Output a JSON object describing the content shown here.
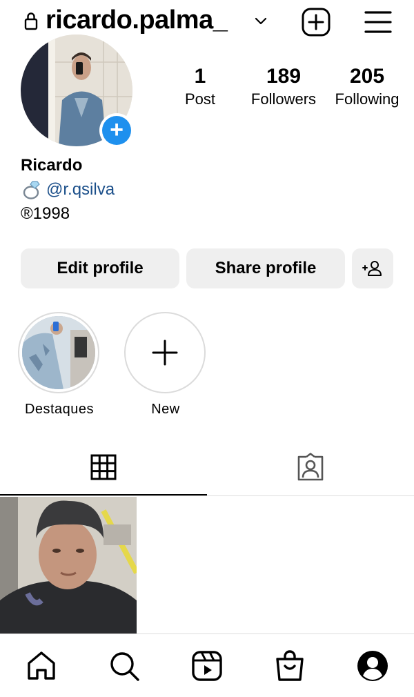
{
  "header": {
    "username": "ricardo.palma_",
    "icons": [
      "lock-icon",
      "chevron-down-icon",
      "new-post-icon",
      "menu-icon"
    ]
  },
  "profile": {
    "stats": {
      "posts": {
        "value": "1",
        "label": "Post"
      },
      "followers": {
        "value": "189",
        "label": "Followers"
      },
      "following": {
        "value": "205",
        "label": "Following"
      }
    },
    "name": "Ricardo",
    "bio_handle": "@r.qsilva",
    "bio_line": "®1998"
  },
  "buttons": {
    "edit": "Edit profile",
    "share": "Share profile"
  },
  "highlights": [
    {
      "label": "Destaques"
    },
    {
      "label": "New"
    }
  ],
  "tabs": [
    "grid-icon",
    "tagged-icon"
  ],
  "bottom_nav": [
    "home-icon",
    "search-icon",
    "reels-icon",
    "shop-icon",
    "profile-icon"
  ],
  "colors": {
    "accent_blue": "#1e90ee",
    "link": "#1b4f8a",
    "button_bg": "#efefef",
    "divider": "#dbdbdb"
  }
}
